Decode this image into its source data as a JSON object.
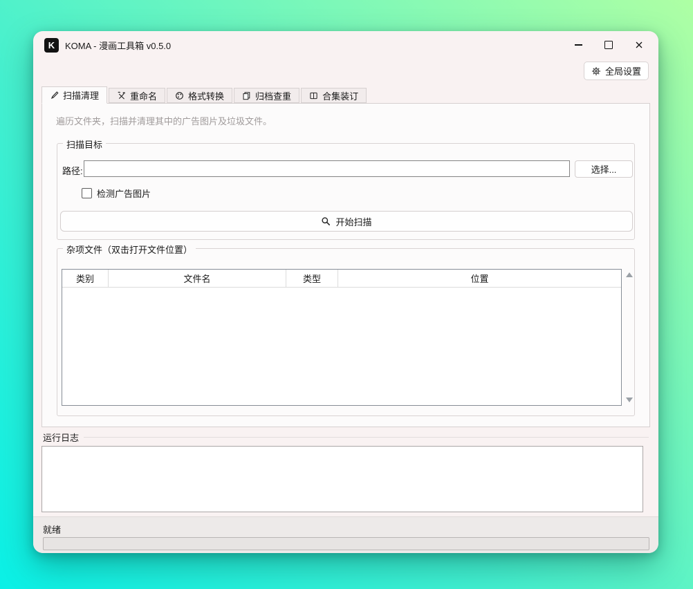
{
  "window": {
    "title": "KOMA - 漫画工具箱 v0.5.0",
    "logo_letter": "K"
  },
  "toolbar": {
    "global_settings_label": "全局设置"
  },
  "tabs": [
    {
      "label": "扫描清理",
      "icon": "brush-icon",
      "active": true
    },
    {
      "label": "重命名",
      "icon": "hammer-wrench-icon",
      "active": false
    },
    {
      "label": "格式转换",
      "icon": "palette-icon",
      "active": false
    },
    {
      "label": "归档查重",
      "icon": "copy-pages-icon",
      "active": false
    },
    {
      "label": "合集装订",
      "icon": "book-icon",
      "active": false
    }
  ],
  "scan_panel": {
    "description": "遍历文件夹，扫描并清理其中的广告图片及垃圾文件。",
    "target_group": {
      "title": "扫描目标",
      "path_label": "路径:",
      "path_value": "",
      "browse_button": "选择...",
      "detect_ads_label": "检测广告图片",
      "detect_ads_checked": false,
      "start_button": "开始扫描",
      "start_button_icon": "magnifier-icon"
    },
    "files_group": {
      "title": "杂项文件（双击打开文件位置）",
      "table": {
        "columns": [
          "类别",
          "文件名",
          "类型",
          "位置"
        ],
        "rows": []
      }
    }
  },
  "log_section": {
    "title": "运行日志",
    "content": ""
  },
  "status_bar": {
    "status_text": "就绪",
    "progress_percent": 0
  },
  "colors": {
    "desktop_gradient_start": "#0af0e6",
    "desktop_gradient_end": "#aeffa4",
    "window_bg": "#f9f2f2",
    "panel_bg": "#fcfbfb"
  }
}
